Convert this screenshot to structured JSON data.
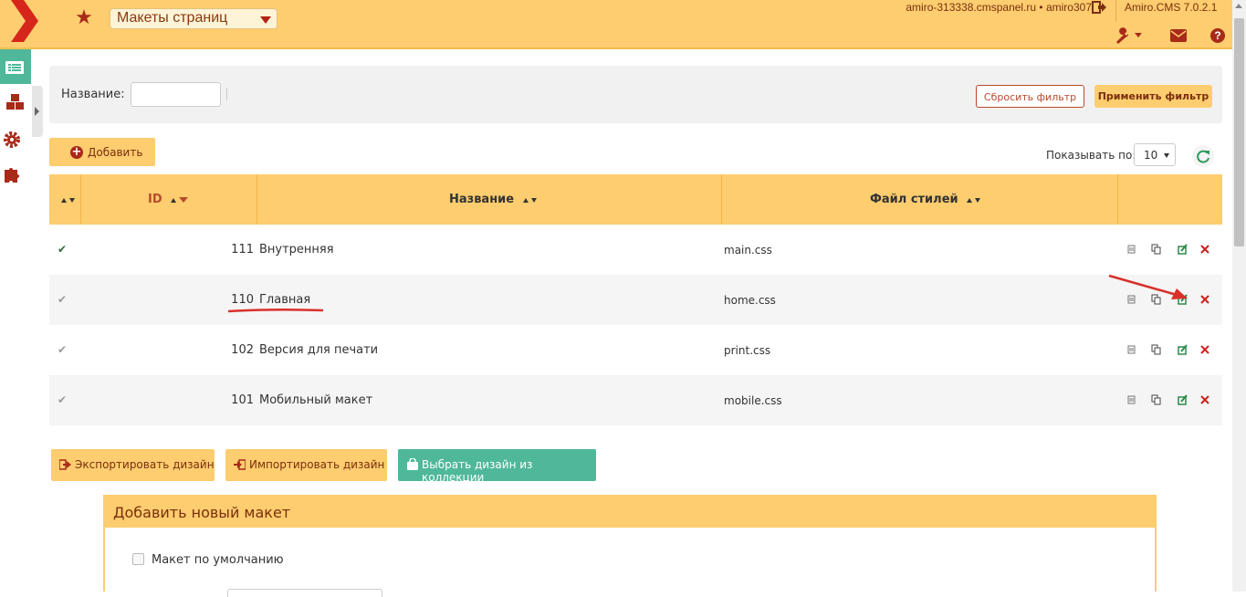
{
  "header": {
    "module_title": "Макеты страниц",
    "host_text": "amiro-313338.cmspanel.ru • amiro307",
    "cms_version": "Amiro.CMS 7.0.2.1",
    "accent_color": "#fdcd6f",
    "brand_color": "#a82a19"
  },
  "sidebar": {
    "items": [
      {
        "icon": "list-icon",
        "active": true
      },
      {
        "icon": "cubes-icon",
        "active": false
      },
      {
        "icon": "gear-icon",
        "active": false
      },
      {
        "icon": "puzzle-icon",
        "active": false
      }
    ]
  },
  "filter": {
    "name_label": "Название:",
    "name_value": "",
    "reset_label": "Сбросить фильтр",
    "apply_label": "Применить фильтр"
  },
  "toolbar": {
    "add_label": "Добавить",
    "show_label": "Показывать по:",
    "per_page": "10"
  },
  "table": {
    "columns": [
      "ID",
      "Название",
      "Файл стилей"
    ],
    "rows": [
      {
        "id": "111",
        "name": "Внутренняя",
        "css": "main.css",
        "default": true
      },
      {
        "id": "110",
        "name": "Главная",
        "css": "home.css",
        "default": false
      },
      {
        "id": "102",
        "name": "Версия для печати",
        "css": "print.css",
        "default": false
      },
      {
        "id": "101",
        "name": "Мобильный макет",
        "css": "mobile.css",
        "default": false
      }
    ]
  },
  "bottom_actions": {
    "export_label": "Экспортировать дизайн",
    "import_label": "Импортировать дизайн",
    "collection_label": "Выбрать дизайн из коллекции"
  },
  "new_layout": {
    "title": "Добавить новый макет",
    "default_checkbox_label": "Макет по умолчанию"
  }
}
